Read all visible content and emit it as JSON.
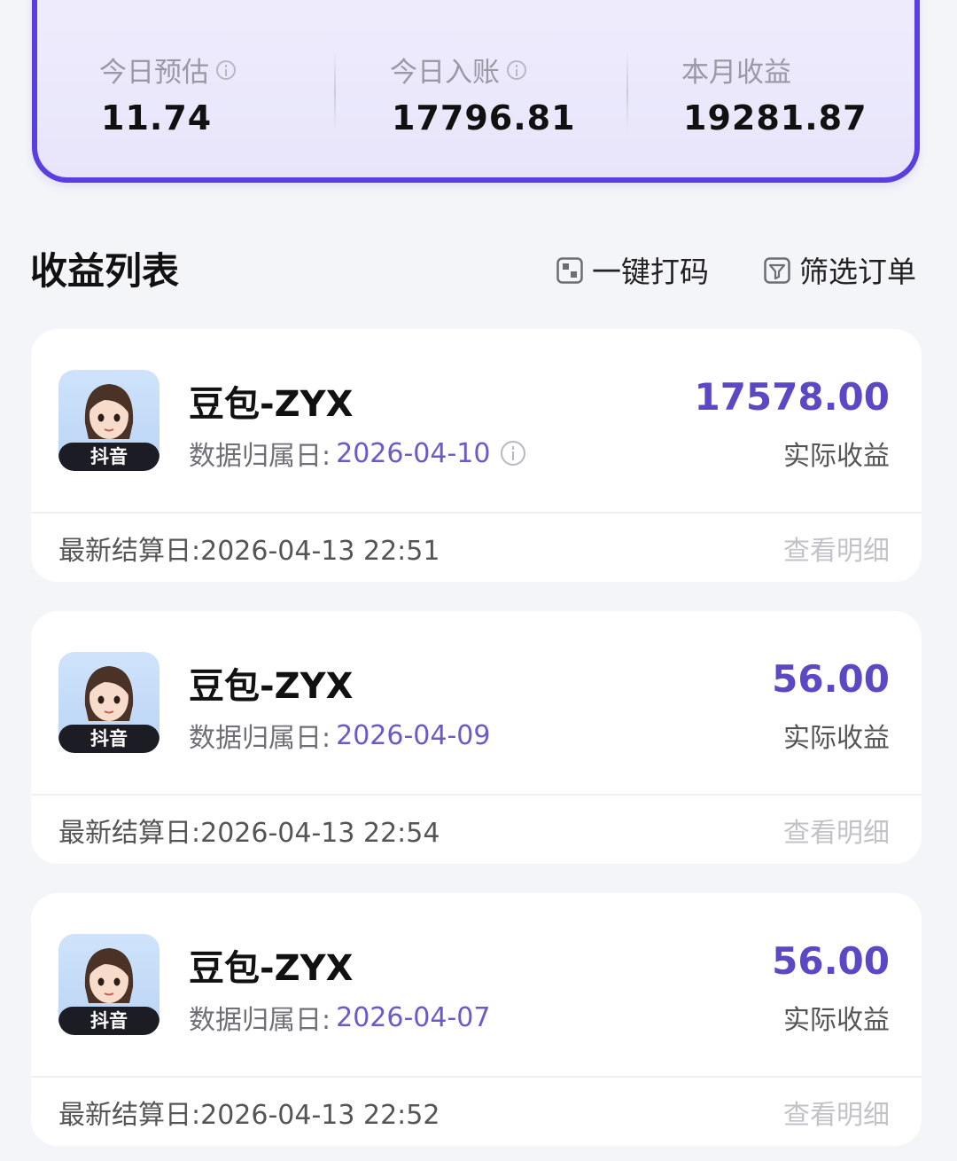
{
  "summary": {
    "today_estimate": {
      "label": "今日预估",
      "value": "11.74"
    },
    "today_credited": {
      "label": "今日入账",
      "value": "17796.81"
    },
    "month_earnings": {
      "label": "本月收益",
      "value": "19281.87"
    }
  },
  "list_header": {
    "title": "收益列表",
    "action_code": "一键打码",
    "action_filter": "筛选订单"
  },
  "records": [
    {
      "name": "豆包-ZYX",
      "platform": "抖音",
      "date_label": "数据归属日:",
      "date": "2026-04-10",
      "amount": "17578.00",
      "amount_label": "实际收益",
      "settle_text": "最新结算日:2026-04-13 22:51",
      "detail_label": "查看明细"
    },
    {
      "name": "豆包-ZYX",
      "platform": "抖音",
      "date_label": "数据归属日:",
      "date": "2026-04-09",
      "amount": "56.00",
      "amount_label": "实际收益",
      "settle_text": "最新结算日:2026-04-13 22:54",
      "detail_label": "查看明细"
    },
    {
      "name": "豆包-ZYX",
      "platform": "抖音",
      "date_label": "数据归属日:",
      "date": "2026-04-07",
      "amount": "56.00",
      "amount_label": "实际收益",
      "settle_text": "最新结算日:2026-04-13 22:52",
      "detail_label": "查看明细"
    }
  ],
  "colors": {
    "accent": "#5b3ee0",
    "amount": "#5b48c4",
    "date": "#6a5bc8",
    "background": "#f4f5f9"
  },
  "icons": {
    "info": "info-circle-icon",
    "code": "mosaic-icon",
    "filter": "filter-list-icon"
  }
}
